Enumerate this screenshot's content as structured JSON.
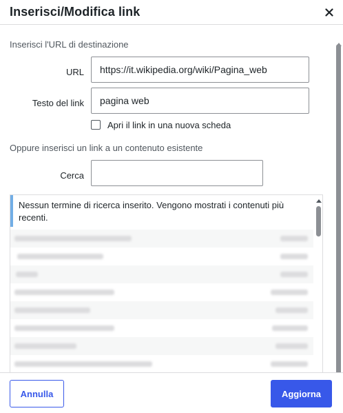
{
  "dialog": {
    "title": "Inserisci/Modifica link",
    "close_label": "×"
  },
  "form": {
    "url_section_label": "Inserisci l'URL di destinazione",
    "url_label": "URL",
    "url_value": "https://it.wikipedia.org/wiki/Pagina_web",
    "link_text_label": "Testo del link",
    "link_text_value": "pagina web",
    "new_tab_label": "Apri il link in una nuova scheda",
    "new_tab_checked": false,
    "existing_section_label": "Oppure inserisci un link a un contenuto esistente",
    "search_label": "Cerca",
    "search_value": ""
  },
  "results": {
    "notice": "Nessun termine di ricerca inserito. Vengono mostrati i contenuti più recenti."
  },
  "footer": {
    "cancel_label": "Annulla",
    "update_label": "Aggiorna"
  },
  "colors": {
    "accent": "#3858e9",
    "notice_border": "#72aee6"
  },
  "icons": {
    "close": "close-icon"
  }
}
